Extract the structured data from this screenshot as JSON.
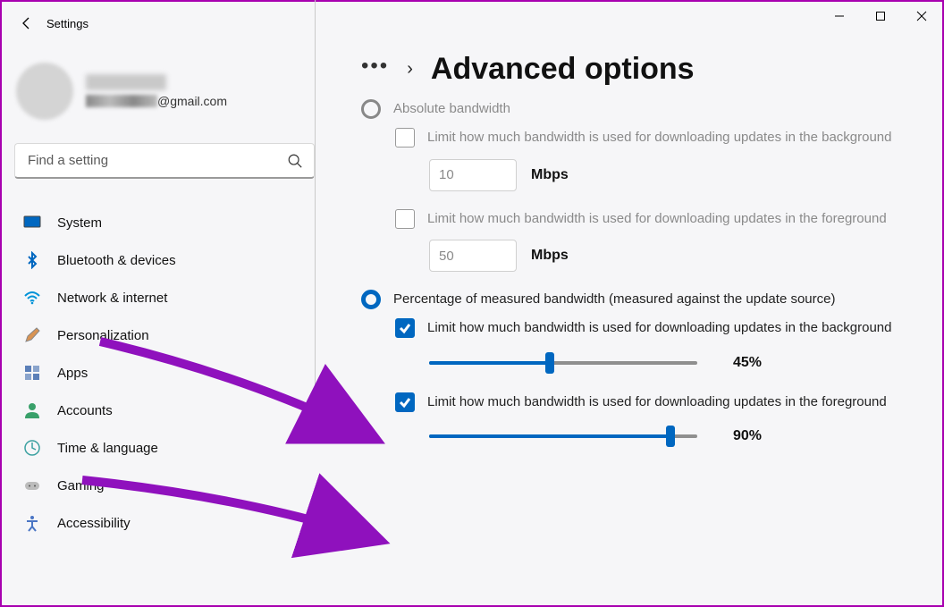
{
  "app": {
    "title": "Settings"
  },
  "account": {
    "email_suffix": "@gmail.com"
  },
  "search": {
    "placeholder": "Find a setting"
  },
  "nav": {
    "items": [
      {
        "label": "System"
      },
      {
        "label": "Bluetooth & devices"
      },
      {
        "label": "Network & internet"
      },
      {
        "label": "Personalization"
      },
      {
        "label": "Apps"
      },
      {
        "label": "Accounts"
      },
      {
        "label": "Time & language"
      },
      {
        "label": "Gaming"
      },
      {
        "label": "Accessibility"
      }
    ]
  },
  "page": {
    "title": "Advanced options"
  },
  "options": {
    "absolute_label": "Absolute bandwidth",
    "abs_bg_label": "Limit how much bandwidth is used for downloading updates in the background",
    "abs_bg_value": "10",
    "abs_fg_label": "Limit how much bandwidth is used for downloading updates in the foreground",
    "abs_fg_value": "50",
    "mbps": "Mbps",
    "percent_label": "Percentage of measured bandwidth (measured against the update source)",
    "pct_bg_label": "Limit how much bandwidth is used for downloading updates in the background",
    "pct_bg_value": "45%",
    "pct_bg_fill": 45,
    "pct_fg_label": "Limit how much bandwidth is used for downloading updates in the foreground",
    "pct_fg_value": "90%",
    "pct_fg_fill": 90
  }
}
